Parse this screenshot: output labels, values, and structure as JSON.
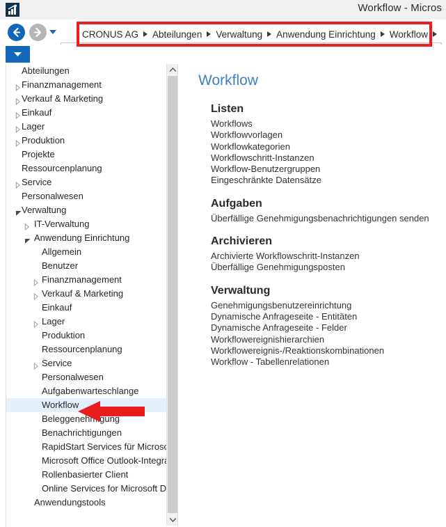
{
  "window": {
    "title": "Workflow - Micros",
    "app_icon": "chart-bars-icon",
    "icon_color": "#12314f"
  },
  "navigation": {
    "back_label": "Zurück",
    "forward_label": "Vorwärts",
    "history_dropdown_label": "Verlauf",
    "address_dropdown_label": "Adressliste",
    "breadcrumb": [
      "CRONUS AG",
      "Abteilungen",
      "Verwaltung",
      "Anwendung Einrichtung",
      "Workflow"
    ],
    "highlight_color": "#ee1c1c",
    "accent_color": "#1267b8"
  },
  "sidebar": {
    "items": [
      {
        "label": "Abteilungen",
        "indent": 1,
        "twisty": "none",
        "selected": false
      },
      {
        "label": "Finanzmanagement",
        "indent": 1,
        "twisty": "collapsed",
        "selected": false
      },
      {
        "label": "Verkauf & Marketing",
        "indent": 1,
        "twisty": "collapsed",
        "selected": false
      },
      {
        "label": "Einkauf",
        "indent": 1,
        "twisty": "collapsed",
        "selected": false
      },
      {
        "label": "Lager",
        "indent": 1,
        "twisty": "collapsed",
        "selected": false
      },
      {
        "label": "Produktion",
        "indent": 1,
        "twisty": "collapsed",
        "selected": false
      },
      {
        "label": "Projekte",
        "indent": 1,
        "twisty": "none",
        "selected": false
      },
      {
        "label": "Ressourcenplanung",
        "indent": 1,
        "twisty": "none",
        "selected": false
      },
      {
        "label": "Service",
        "indent": 1,
        "twisty": "collapsed",
        "selected": false
      },
      {
        "label": "Personalwesen",
        "indent": 1,
        "twisty": "none",
        "selected": false
      },
      {
        "label": "Verwaltung",
        "indent": 1,
        "twisty": "expanded",
        "selected": false
      },
      {
        "label": "IT-Verwaltung",
        "indent": 2,
        "twisty": "collapsed",
        "selected": false
      },
      {
        "label": "Anwendung Einrichtung",
        "indent": 2,
        "twisty": "expanded",
        "selected": false
      },
      {
        "label": "Allgemein",
        "indent": 3,
        "twisty": "none",
        "selected": false
      },
      {
        "label": "Benutzer",
        "indent": 3,
        "twisty": "none",
        "selected": false
      },
      {
        "label": "Finanzmanagement",
        "indent": 3,
        "twisty": "collapsed",
        "selected": false
      },
      {
        "label": "Verkauf & Marketing",
        "indent": 3,
        "twisty": "collapsed",
        "selected": false
      },
      {
        "label": "Einkauf",
        "indent": 3,
        "twisty": "none",
        "selected": false
      },
      {
        "label": "Lager",
        "indent": 3,
        "twisty": "collapsed",
        "selected": false
      },
      {
        "label": "Produktion",
        "indent": 3,
        "twisty": "none",
        "selected": false
      },
      {
        "label": "Ressourcenplanung",
        "indent": 3,
        "twisty": "none",
        "selected": false
      },
      {
        "label": "Service",
        "indent": 3,
        "twisty": "collapsed",
        "selected": false
      },
      {
        "label": "Personalwesen",
        "indent": 3,
        "twisty": "none",
        "selected": false
      },
      {
        "label": "Aufgabenwarteschlange",
        "indent": 3,
        "twisty": "none",
        "selected": false
      },
      {
        "label": "Workflow",
        "indent": 3,
        "twisty": "none",
        "selected": true
      },
      {
        "label": "Beleggenehmigung",
        "indent": 3,
        "twisty": "none",
        "selected": false
      },
      {
        "label": "Benachrichtigungen",
        "indent": 3,
        "twisty": "none",
        "selected": false
      },
      {
        "label": "RapidStart Services für Microsoft Dyn",
        "indent": 3,
        "twisty": "none",
        "selected": false
      },
      {
        "label": "Microsoft Office Outlook-Integration",
        "indent": 3,
        "twisty": "none",
        "selected": false
      },
      {
        "label": "Rollenbasierter Client",
        "indent": 3,
        "twisty": "none",
        "selected": false
      },
      {
        "label": "Online Services for Microsoft Dynami",
        "indent": 3,
        "twisty": "none",
        "selected": false
      },
      {
        "label": "Anwendungstools",
        "indent": 2,
        "twisty": "none",
        "selected": false
      }
    ],
    "selection_color": "#e3effb",
    "scrollbar": {
      "up_arrow": "chevron-up-icon",
      "down_arrow": "chevron-down-icon"
    }
  },
  "main": {
    "title": "Workflow",
    "title_color": "#3f7ec2",
    "groups": [
      {
        "title": "Listen",
        "links": [
          "Workflows",
          "Workflowvorlagen",
          "Workflowkategorien",
          "Workflowschritt-Instanzen",
          "Workflow-Benutzergruppen",
          "Eingeschränkte Datensätze"
        ]
      },
      {
        "title": "Aufgaben",
        "links": [
          "Überfällige Genehmigungsbenachrichtigungen senden"
        ]
      },
      {
        "title": "Archivieren",
        "links": [
          "Archivierte Workflowschritt-Instanzen",
          "Überfällige Genehmigungsposten"
        ]
      },
      {
        "title": "Verwaltung",
        "links": [
          "Genehmigungsbenutzereinrichtung",
          "Dynamische Anfrageseite - Entitäten",
          "Dynamische Anfrageseite - Felder",
          "Workflowereignishierarchien",
          "Workflowereignis-/Reaktionskombinationen",
          "Workflow - Tabellenrelationen"
        ]
      }
    ]
  },
  "annotation": {
    "arrow_label": "pointer-arrow-to-workflow",
    "arrow_color": "#e81d1d",
    "box_label": "breadcrumb-highlight-box"
  }
}
